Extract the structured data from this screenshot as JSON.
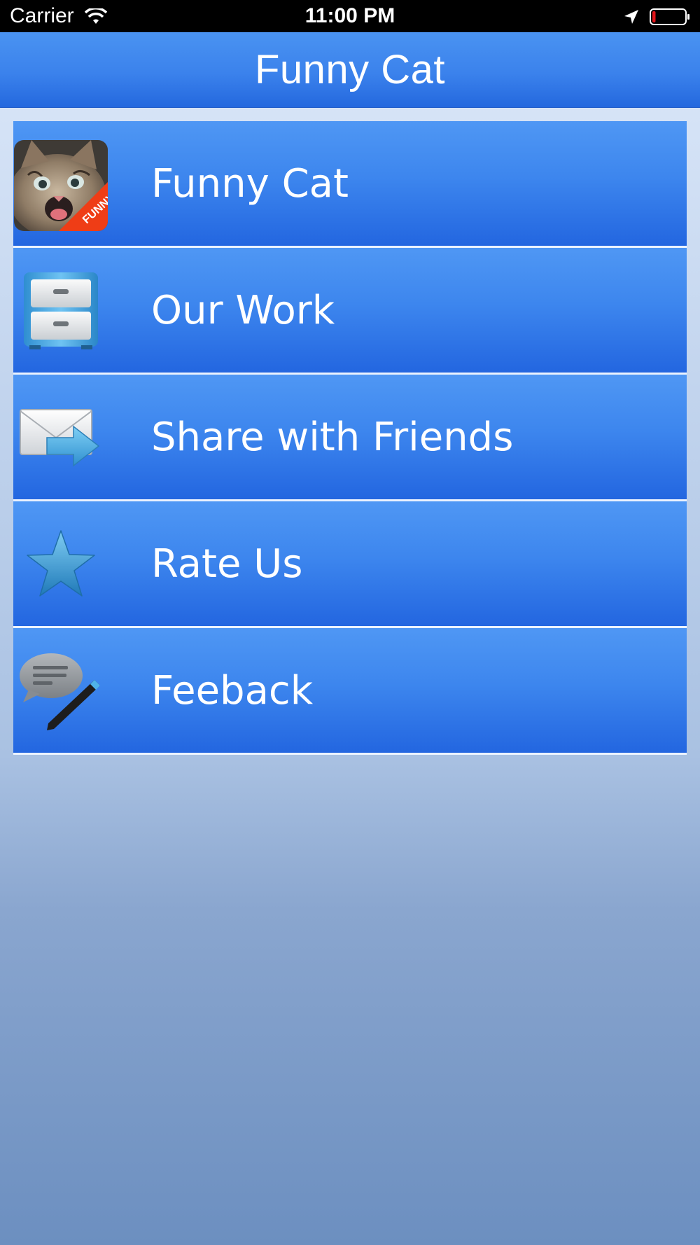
{
  "status_bar": {
    "carrier": "Carrier",
    "time": "11:00 PM",
    "battery_level": 0.1
  },
  "nav": {
    "title": "Funny Cat"
  },
  "menu": {
    "items": [
      {
        "label": "Funny Cat",
        "icon": "cat-app-icon",
        "badge": "FUNNY"
      },
      {
        "label": "Our Work",
        "icon": "file-cabinet-icon"
      },
      {
        "label": "Share with Friends",
        "icon": "mail-forward-icon"
      },
      {
        "label": "Rate Us",
        "icon": "star-icon"
      },
      {
        "label": "Feeback",
        "icon": "speech-bubble-pen-icon"
      }
    ]
  },
  "colors": {
    "nav_top": "#4a93f1",
    "nav_bottom": "#2468de",
    "row_top": "#4f97f4",
    "row_bottom": "#2366e0",
    "background_top": "#dde9fa",
    "background_bottom": "#6c8fc0"
  }
}
